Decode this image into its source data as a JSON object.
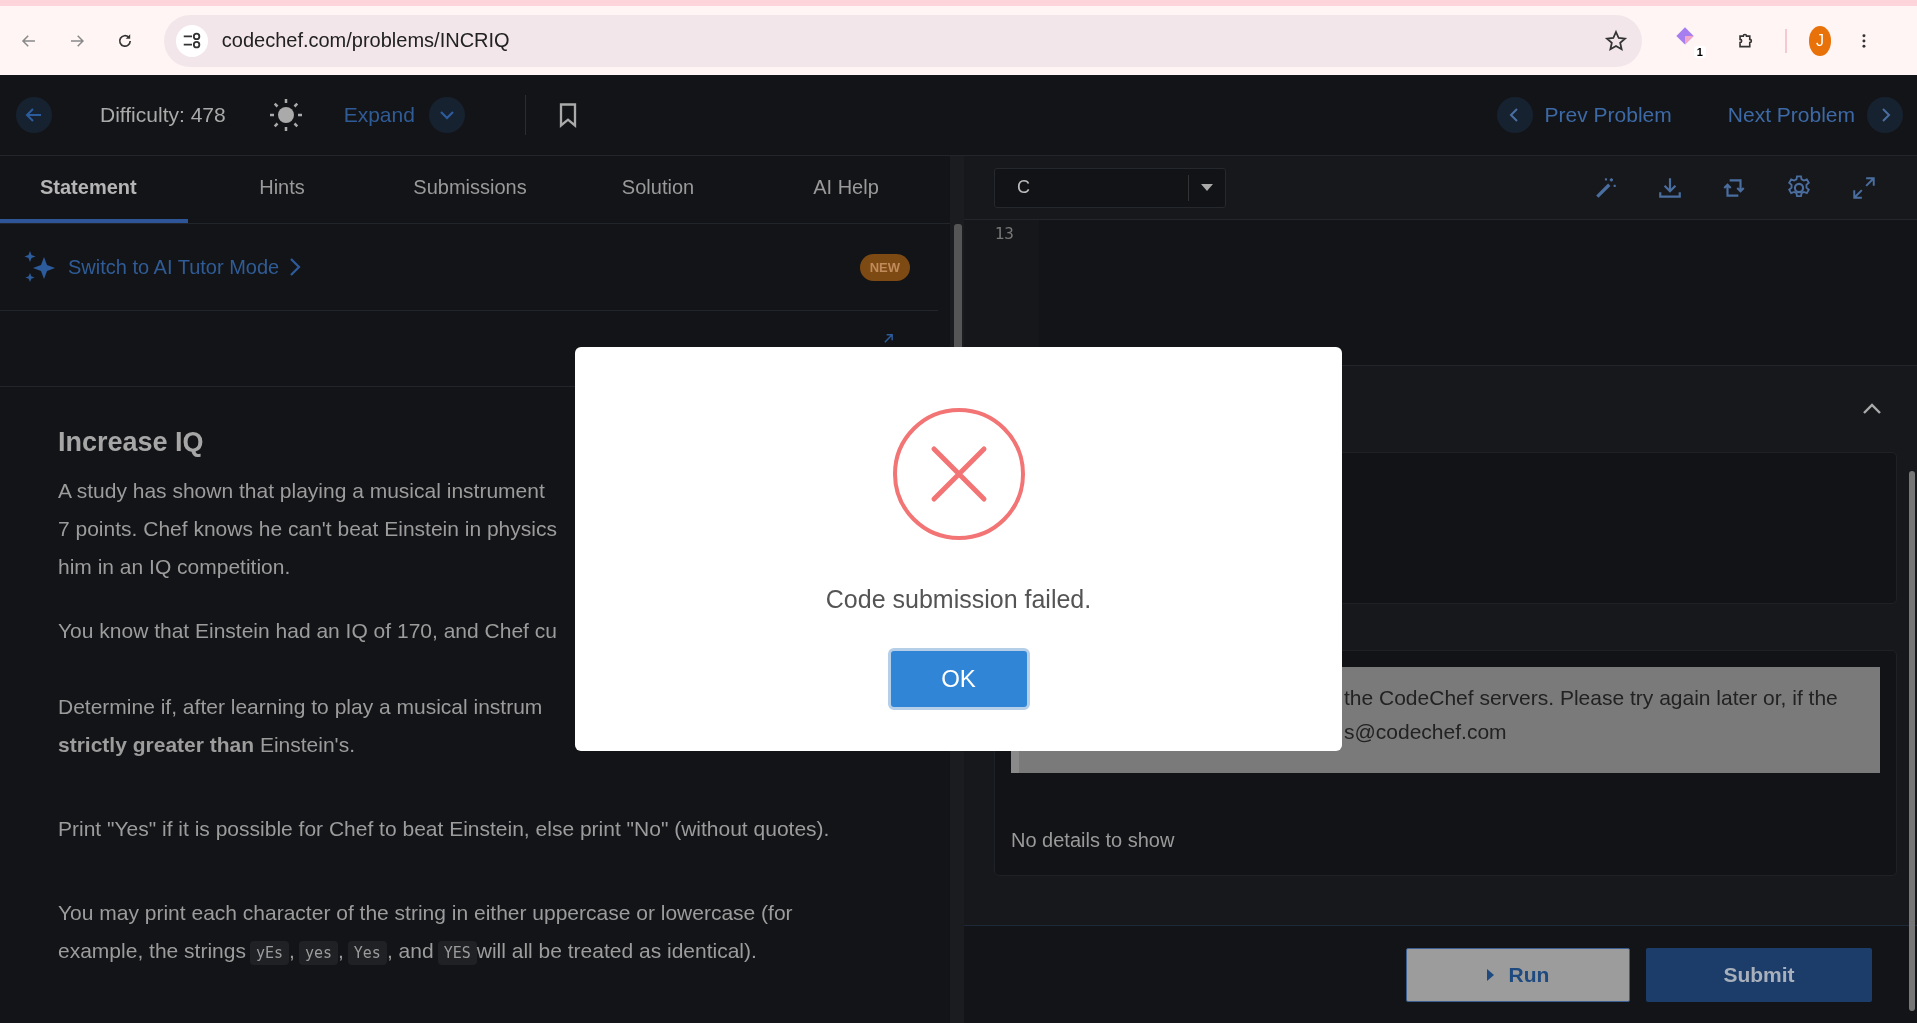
{
  "browser": {
    "url": "codechef.com/problems/INCRIQ",
    "extension_badge": "1",
    "avatar_initial": "J"
  },
  "header": {
    "difficulty": "Difficulty: 478",
    "expand": "Expand",
    "prev": "Prev Problem",
    "next": "Next Problem"
  },
  "tabs": [
    {
      "label": "Statement",
      "selected": true
    },
    {
      "label": "Hints",
      "selected": false
    },
    {
      "label": "Submissions",
      "selected": false
    },
    {
      "label": "Solution",
      "selected": false
    },
    {
      "label": "AI Help",
      "selected": false
    }
  ],
  "ai_tutor": {
    "label": "Switch to AI Tutor Mode",
    "badge": "NEW"
  },
  "problem": {
    "title": "Increase IQ",
    "paragraphs": [
      {
        "lines": [
          [
            {
              "kind": "text",
              "text": "A study has shown that playing a musical instrument"
            }
          ],
          [
            {
              "kind": "text",
              "text": "7 points. Chef knows he can't beat Einstein in physics"
            }
          ],
          [
            {
              "kind": "text",
              "text": "him in an IQ competition."
            }
          ]
        ]
      },
      {
        "lines": [
          [
            {
              "kind": "text",
              "text": "You know that Einstein had an IQ of 170, and Chef cu"
            }
          ]
        ]
      },
      {
        "lines": [
          [
            {
              "kind": "text",
              "text": "Determine if, after learning to play a musical instrum"
            }
          ],
          [
            {
              "kind": "text",
              "text": "**strictly greater than** Einstein's."
            }
          ]
        ]
      },
      {
        "lines": [
          [
            {
              "kind": "text",
              "text": "Print \"Yes\" if it is possible for Chef to beat Einstein, else print \"No\" (without quotes)."
            }
          ]
        ]
      },
      {
        "lines": [
          [
            {
              "kind": "text",
              "text": "You may print each character of the string in either uppercase or lowercase (for"
            }
          ],
          [
            {
              "kind": "text",
              "text": "example, the strings"
            },
            {
              "kind": "code",
              "text": "yEs"
            },
            {
              "kind": "text",
              "text": ","
            },
            {
              "kind": "code",
              "text": "yes"
            },
            {
              "kind": "text",
              "text": ","
            },
            {
              "kind": "code",
              "text": "Yes"
            },
            {
              "kind": "text",
              "text": ", and"
            },
            {
              "kind": "code",
              "text": "YES"
            },
            {
              "kind": "text",
              "text": "will all be treated as identical)."
            }
          ]
        ]
      }
    ]
  },
  "editor": {
    "language": "C",
    "line_numbers": [
      "13"
    ]
  },
  "result": {
    "message_lines": [
      "the CodeChef servers. Please try again later or, if the",
      "s@codechef.com"
    ],
    "no_details": "No details to show"
  },
  "buttons": {
    "run": "Run",
    "submit": "Submit"
  },
  "modal": {
    "message": "Code submission failed.",
    "ok": "OK"
  }
}
